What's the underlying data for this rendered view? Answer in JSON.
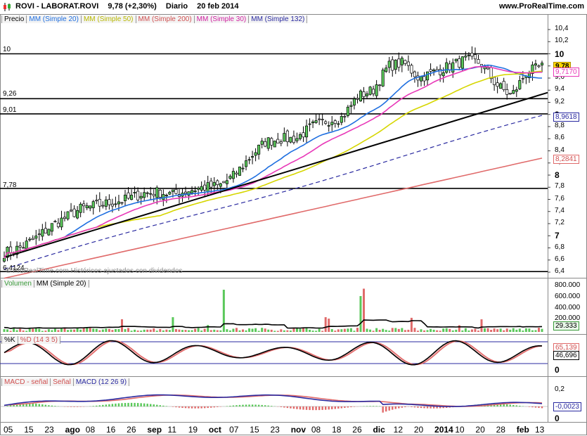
{
  "header": {
    "symbol": "ROVI - LABORAT.ROVI",
    "price": "9,78 (+2,30%)",
    "period": "Diario",
    "date": "20 feb 2014",
    "site": "www.ProRealTime.com"
  },
  "price_legend": [
    "Precio",
    "MM (Simple 20)",
    "MM (Simple 50)",
    "MM (Simple 200)",
    "MM (Simple 30)",
    "MM (Simple 132)"
  ],
  "volume_legend": [
    "Volumen",
    "MM (Simple 20)"
  ],
  "stoch_legend": [
    "%K",
    "%D (14 3 5)"
  ],
  "macd_legend": [
    "MACD - señal",
    "Señal",
    "MACD (12 26 9)"
  ],
  "watermark": "© ProRealTime.com Históricos ajustados con dividendos",
  "colors": {
    "up": "#5ac85a",
    "down": "#ffffff",
    "sma20": "#1f6fe0",
    "sma50": "#d6d600",
    "sma200": "#e06a6a",
    "sma30": "#e838b8",
    "sma132": "#2a2aa0",
    "trend": "#000000"
  },
  "chart_data": [
    {
      "type": "candlestick",
      "title": "ROVI - LABORAT.ROVI",
      "ylim": [
        6.3,
        10.6
      ],
      "y_ticks": [
        "6,4",
        "6,6",
        "6,8",
        "7",
        "7,2",
        "7,4",
        "7,6",
        "7,8",
        "8",
        "8,2",
        "8,4",
        "8,6",
        "8,8",
        "9",
        "9,2",
        "9,4",
        "9,6",
        "9,8",
        "10",
        "10,2",
        "10,4"
      ],
      "x_ticks": [
        "05",
        "15",
        "23",
        "ago",
        "08",
        "16",
        "26",
        "sep",
        "11",
        "19",
        "oct",
        "07",
        "15",
        "23",
        "nov",
        "08",
        "18",
        "26",
        "dic",
        "12",
        "20",
        "2014",
        "10",
        "20",
        "28",
        "feb",
        "13"
      ],
      "x_bold": [
        "ago",
        "sep",
        "oct",
        "nov",
        "dic",
        "2014",
        "feb"
      ],
      "horizontal_levels": [
        {
          "label": "10",
          "value": 10.0
        },
        {
          "label": "9,26",
          "value": 9.26
        },
        {
          "label": "9,01",
          "value": 9.01
        },
        {
          "label": "7,78",
          "value": 7.78
        },
        {
          "label": "6,4124",
          "value": 6.41
        }
      ],
      "last_values": {
        "price": "9,78",
        "sma20": "9,77",
        "sma30": "9,7170",
        "sma132": "8,9618",
        "sma200": "8,2841"
      },
      "close_anchors": [
        6.72,
        6.8,
        6.95,
        7.15,
        7.3,
        7.45,
        7.5,
        7.55,
        7.6,
        7.7,
        7.72,
        7.68,
        7.75,
        7.8,
        7.82,
        8.0,
        8.3,
        8.55,
        8.6,
        8.6,
        8.8,
        8.9,
        8.95,
        9.3,
        9.4,
        9.8,
        9.85,
        9.6,
        9.7,
        9.8,
        9.9,
        9.85,
        9.5,
        9.3,
        9.7,
        9.78
      ]
    },
    {
      "type": "bar",
      "title": "Volumen",
      "y_ticks": [
        "200.000",
        "400.000",
        "600.000",
        "800.000"
      ],
      "last_value": "29.333"
    },
    {
      "type": "line",
      "title": "%K %D (14 3 5)",
      "y_ticks": [
        "0"
      ],
      "last_values": {
        "k": "46,696",
        "d": "65,139"
      }
    },
    {
      "type": "line",
      "title": "MACD (12 26 9)",
      "y_ticks": [
        "0,2",
        "0"
      ],
      "last_value": "-0,0023"
    }
  ]
}
